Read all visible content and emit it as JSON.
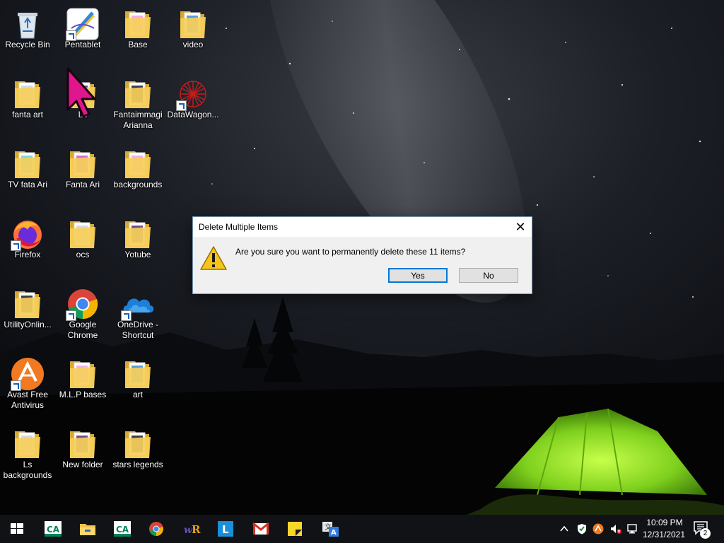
{
  "desktop": {
    "icons": [
      {
        "label": "Recycle Bin",
        "icon": "recycle-bin-icon"
      },
      {
        "label": "Pentablet",
        "icon": "pentablet-icon"
      },
      {
        "label": "Base",
        "icon": "folder-icon"
      },
      {
        "label": "video",
        "icon": "folder-icon"
      },
      {
        "label": "fanta art",
        "icon": "folder-icon"
      },
      {
        "label": "Ls",
        "icon": "folder-icon"
      },
      {
        "label": "Fantaimmagi\nArianna",
        "icon": "folder-icon"
      },
      {
        "label": "DataWagon...",
        "icon": "datawagon-icon"
      },
      {
        "label": "TV  fata Ari",
        "icon": "folder-icon"
      },
      {
        "label": "Fanta Ari",
        "icon": "folder-icon"
      },
      {
        "label": "backgrounds",
        "icon": "folder-icon"
      },
      {
        "label": "Firefox",
        "icon": "firefox-icon"
      },
      {
        "label": "ocs",
        "icon": "folder-icon"
      },
      {
        "label": "Yotube",
        "icon": "folder-icon"
      },
      {
        "label": "UtilityOnlin...",
        "icon": "folder-icon"
      },
      {
        "label": "Google\nChrome",
        "icon": "chrome-icon"
      },
      {
        "label": "OneDrive -\nShortcut",
        "icon": "onedrive-icon"
      },
      {
        "label": "Avast Free\nAntivirus",
        "icon": "avast-icon"
      },
      {
        "label": "M.L.P bases",
        "icon": "folder-icon"
      },
      {
        "label": "art",
        "icon": "folder-icon"
      },
      {
        "label": "Ls\nbackgrounds",
        "icon": "folder-icon"
      },
      {
        "label": "New folder",
        "icon": "folder-icon"
      },
      {
        "label": "stars legends",
        "icon": "folder-icon"
      }
    ]
  },
  "dialog": {
    "title": "Delete Multiple Items",
    "close_glyph": "✕",
    "message": "Are you sure you want to permanently delete these 11 items?",
    "yes_label": "Yes",
    "no_label": "No",
    "icon": "warning-icon"
  },
  "taskbar": {
    "pinned": [
      {
        "name": "credit-agricole-icon"
      },
      {
        "name": "file-explorer-icon"
      },
      {
        "name": "credit-agricole-icon"
      },
      {
        "name": "chrome-icon"
      },
      {
        "name": "wr-icon"
      },
      {
        "name": "l-app-icon"
      },
      {
        "name": "gmail-icon"
      },
      {
        "name": "sticky-notes-icon"
      },
      {
        "name": "translate-icon"
      }
    ],
    "tray": {
      "time": "10:09 PM",
      "date": "12/31/2021",
      "notification_count": "2"
    }
  },
  "colors": {
    "taskbar_bg": "#101216",
    "dialog_bg": "#f0f0f0",
    "accent": "#0078d7",
    "tent": "#8ee02a",
    "cursor": "#e0168c"
  }
}
